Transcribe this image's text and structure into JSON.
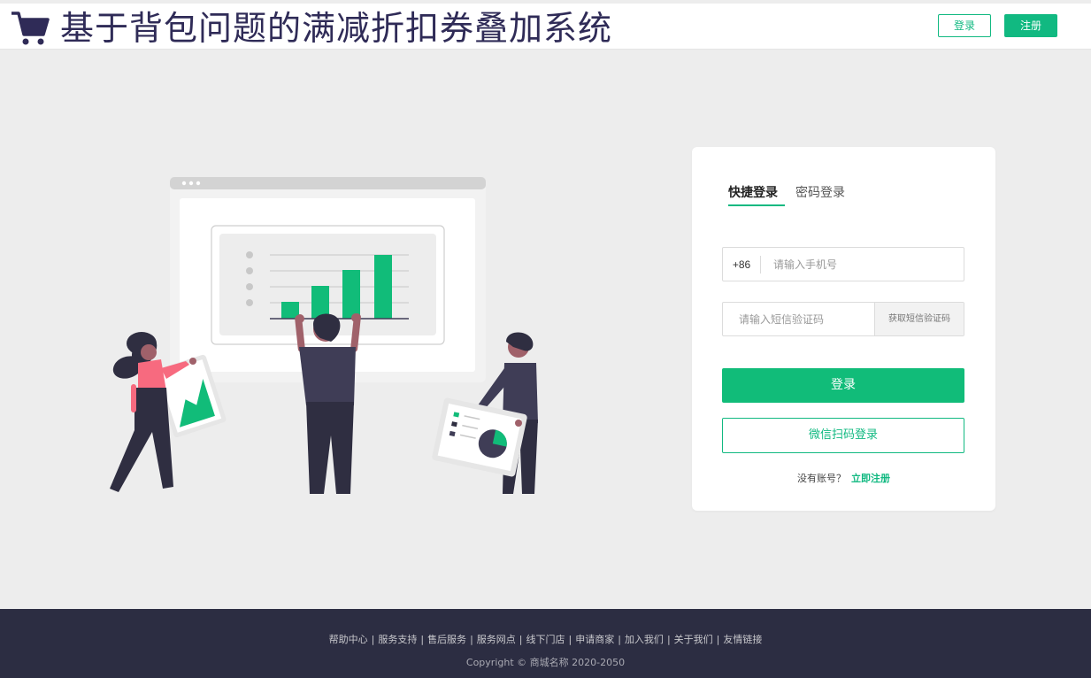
{
  "header": {
    "title": "基于背包问题的满减折扣券叠加系统",
    "login_label": "登录",
    "register_label": "注册",
    "brand_icon": "shopping-cart-icon"
  },
  "login_card": {
    "tabs": [
      {
        "label": "快捷登录",
        "active": true
      },
      {
        "label": "密码登录",
        "active": false
      }
    ],
    "phone_prefix": "+86",
    "phone_placeholder": "请输入手机号",
    "code_placeholder": "请输入短信验证码",
    "sms_button_label": "获取短信验证码",
    "login_button_label": "登录",
    "wechat_button_label": "微信扫码登录",
    "no_account_text": "没有账号？",
    "register_link_label": "立即注册"
  },
  "footer": {
    "links": [
      "帮助中心",
      "服务支持",
      "售后服务",
      "服务网点",
      "线下门店",
      "申请商家",
      "加入我们",
      "关于我们",
      "友情链接"
    ],
    "separator": "|",
    "copyright": "Copyright © 商城名称  2020-2050"
  },
  "colors": {
    "accent": "#11b981",
    "brand_text": "#2f2b57",
    "footer_bg": "#2c2d42",
    "page_bg": "#ededed"
  }
}
